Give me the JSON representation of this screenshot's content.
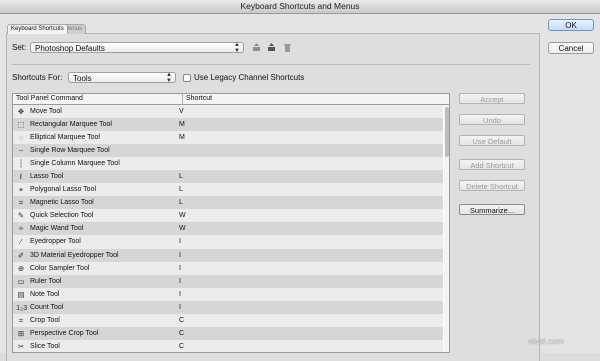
{
  "window": {
    "title": "Keyboard Shortcuts and Menus"
  },
  "tabs": [
    {
      "label": "Keyboard Shortcuts"
    },
    {
      "label": "Menus"
    }
  ],
  "set": {
    "label": "Set:",
    "value": "Photoshop Defaults"
  },
  "shortcuts_for": {
    "label": "Shortcuts For:",
    "value": "Tools"
  },
  "legacy_checkbox": {
    "label": "Use Legacy Channel Shortcuts",
    "checked": false
  },
  "table": {
    "headers": [
      "Tool Panel Command",
      "Shortcut"
    ],
    "rows": [
      {
        "icon": "move-icon",
        "glyph": "✥",
        "name": "Move Tool",
        "shortcut": "V"
      },
      {
        "icon": "rectangular-marquee-icon",
        "glyph": "⬚",
        "name": "Rectangular Marquee Tool",
        "shortcut": "M"
      },
      {
        "icon": "elliptical-marquee-icon",
        "glyph": "◌",
        "name": "Elliptical Marquee Tool",
        "shortcut": "M"
      },
      {
        "icon": "single-row-marquee-icon",
        "glyph": "┄",
        "name": "Single Row Marquee Tool",
        "shortcut": ""
      },
      {
        "icon": "single-column-marquee-icon",
        "glyph": "┆",
        "name": "Single Column Marquee Tool",
        "shortcut": ""
      },
      {
        "icon": "lasso-icon",
        "glyph": "ℓ",
        "name": "Lasso Tool",
        "shortcut": "L"
      },
      {
        "icon": "polygonal-lasso-icon",
        "glyph": "⌖",
        "name": "Polygonal Lasso Tool",
        "shortcut": "L"
      },
      {
        "icon": "magnetic-lasso-icon",
        "glyph": "⌗",
        "name": "Magnetic Lasso Tool",
        "shortcut": "L"
      },
      {
        "icon": "quick-selection-icon",
        "glyph": "✎",
        "name": "Quick Selection Tool",
        "shortcut": "W"
      },
      {
        "icon": "magic-wand-icon",
        "glyph": "✧",
        "name": "Magic Wand Tool",
        "shortcut": "W"
      },
      {
        "icon": "eyedropper-icon",
        "glyph": "⁄",
        "name": "Eyedropper Tool",
        "shortcut": "I"
      },
      {
        "icon": "3d-material-eyedropper-icon",
        "glyph": "✐",
        "name": "3D Material Eyedropper Tool",
        "shortcut": "I"
      },
      {
        "icon": "color-sampler-icon",
        "glyph": "⊕",
        "name": "Color Sampler Tool",
        "shortcut": "I"
      },
      {
        "icon": "ruler-icon",
        "glyph": "▭",
        "name": "Ruler Tool",
        "shortcut": "I"
      },
      {
        "icon": "note-icon",
        "glyph": "▤",
        "name": "Note Tool",
        "shortcut": "I"
      },
      {
        "icon": "count-icon",
        "glyph": "1₂3",
        "name": "Count Tool",
        "shortcut": "I"
      },
      {
        "icon": "crop-icon",
        "glyph": "⌗",
        "name": "Crop Tool",
        "shortcut": "C"
      },
      {
        "icon": "perspective-crop-icon",
        "glyph": "⊞",
        "name": "Perspective Crop Tool",
        "shortcut": "C"
      },
      {
        "icon": "slice-icon",
        "glyph": "✂",
        "name": "Slice Tool",
        "shortcut": "C"
      }
    ]
  },
  "actions": [
    {
      "label": "Accept",
      "enabled": false
    },
    {
      "label": "Undo",
      "enabled": false
    },
    {
      "label": "Use Default",
      "enabled": false
    },
    {
      "label": "Add Shortcut",
      "enabled": false
    },
    {
      "label": "Delete Shortcut",
      "enabled": false
    },
    {
      "label": "Summarize...",
      "enabled": true
    }
  ],
  "dialog_buttons": {
    "ok": "OK",
    "cancel": "Cancel"
  },
  "watermark": "vtvid.com"
}
